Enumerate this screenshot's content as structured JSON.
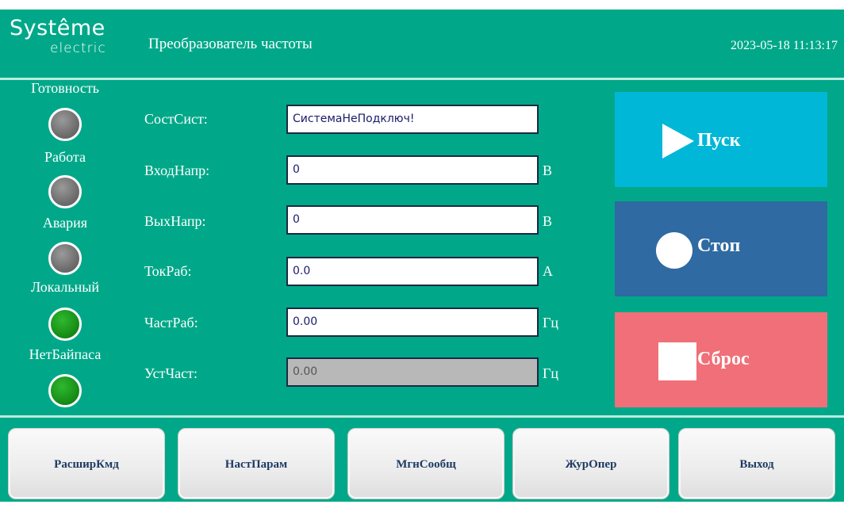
{
  "header": {
    "logo_main": "Systême",
    "logo_sub": "electric",
    "title": "Преобразователь частоты",
    "datetime": "2023-05-18 11:13:17"
  },
  "indicators": [
    {
      "label": "Готовность",
      "state": "off",
      "color": "#7a7a7a"
    },
    {
      "label": "Работа",
      "state": "off",
      "color": "#7a7a7a"
    },
    {
      "label": "Авария",
      "state": "off",
      "color": "#7a7a7a"
    },
    {
      "label": "Локальный",
      "state": "on",
      "color": "#1e9a1e"
    },
    {
      "label": "НетБайпаса",
      "state": "on",
      "color": "#1e9a1e"
    }
  ],
  "fields": [
    {
      "label": "СостСист:",
      "value": "СистемаНеПодключ!",
      "unit": ""
    },
    {
      "label": "ВходНапр:",
      "value": "0",
      "unit": "В"
    },
    {
      "label": "ВыхНапр:",
      "value": "0",
      "unit": "В"
    },
    {
      "label": "ТокРаб:",
      "value": "0.0",
      "unit": "А"
    },
    {
      "label": "ЧастРаб:",
      "value": "0.00",
      "unit": "Гц"
    },
    {
      "label": "УстЧаст:",
      "value": "0.00",
      "unit": "Гц",
      "disabled": true
    }
  ],
  "controls": {
    "start_label": "Пуск",
    "stop_label": "Стоп",
    "reset_label": "Сброс"
  },
  "nav": [
    {
      "label": "РасширКмд"
    },
    {
      "label": "НастПарам"
    },
    {
      "label": "МгнСообщ"
    },
    {
      "label": "ЖурОпер"
    },
    {
      "label": "Выход"
    }
  ],
  "colors": {
    "background": "#00a889",
    "start": "#00b7d8",
    "stop": "#2f6aa2",
    "reset": "#f06f78",
    "led_off": "#7a7a7a",
    "led_on": "#1e9a1e"
  }
}
